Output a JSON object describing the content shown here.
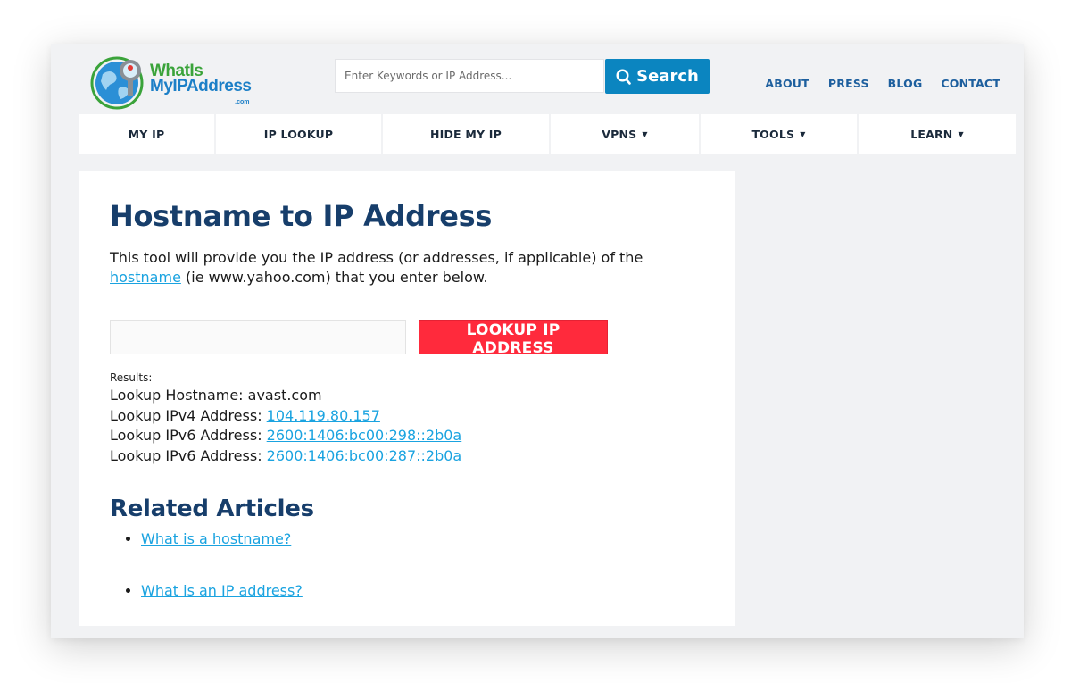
{
  "header": {
    "logo": {
      "line1": "WhatIs",
      "line2": "MyIPAddress",
      "suffix": ".com",
      "icon": "globe-magnifier-icon"
    },
    "search": {
      "placeholder": "Enter Keywords or IP Address...",
      "value": "",
      "button_label": "Search",
      "button_icon": "search-icon"
    },
    "links": [
      "ABOUT",
      "PRESS",
      "BLOG",
      "CONTACT"
    ]
  },
  "nav": {
    "items": [
      {
        "label": "MY IP",
        "dropdown": false
      },
      {
        "label": "IP LOOKUP",
        "dropdown": false
      },
      {
        "label": "HIDE MY IP",
        "dropdown": false
      },
      {
        "label": "VPNS",
        "dropdown": true
      },
      {
        "label": "TOOLS",
        "dropdown": true
      },
      {
        "label": "LEARN",
        "dropdown": true
      }
    ],
    "caret": "▼"
  },
  "main": {
    "title": "Hostname to IP Address",
    "intro_before": "This tool will provide you the IP address (or addresses, if applicable) of the ",
    "intro_link": "hostname",
    "intro_after": " (ie www.yahoo.com) that you enter below.",
    "hostname_input_value": "",
    "lookup_button": "LOOKUP IP ADDRESS",
    "results_label": "Results:",
    "results": [
      {
        "label": "Lookup Hostname: ",
        "value": "avast.com",
        "link": false
      },
      {
        "label": "Lookup IPv4 Address: ",
        "value": "104.119.80.157",
        "link": true
      },
      {
        "label": "Lookup IPv6 Address: ",
        "value": "2600:1406:bc00:298::2b0a",
        "link": true
      },
      {
        "label": "Lookup IPv6 Address: ",
        "value": "2600:1406:bc00:287::2b0a",
        "link": true
      }
    ],
    "related_title": "Related Articles",
    "related_articles": [
      "What is a hostname?",
      "What is an IP address?"
    ]
  },
  "colors": {
    "heading": "#173e6b",
    "link": "#1aa3e0",
    "search_button": "#0b85c0",
    "lookup_button": "#ff2a3c",
    "top_links": "#1d5f9e",
    "page_bg": "#f1f2f4"
  }
}
